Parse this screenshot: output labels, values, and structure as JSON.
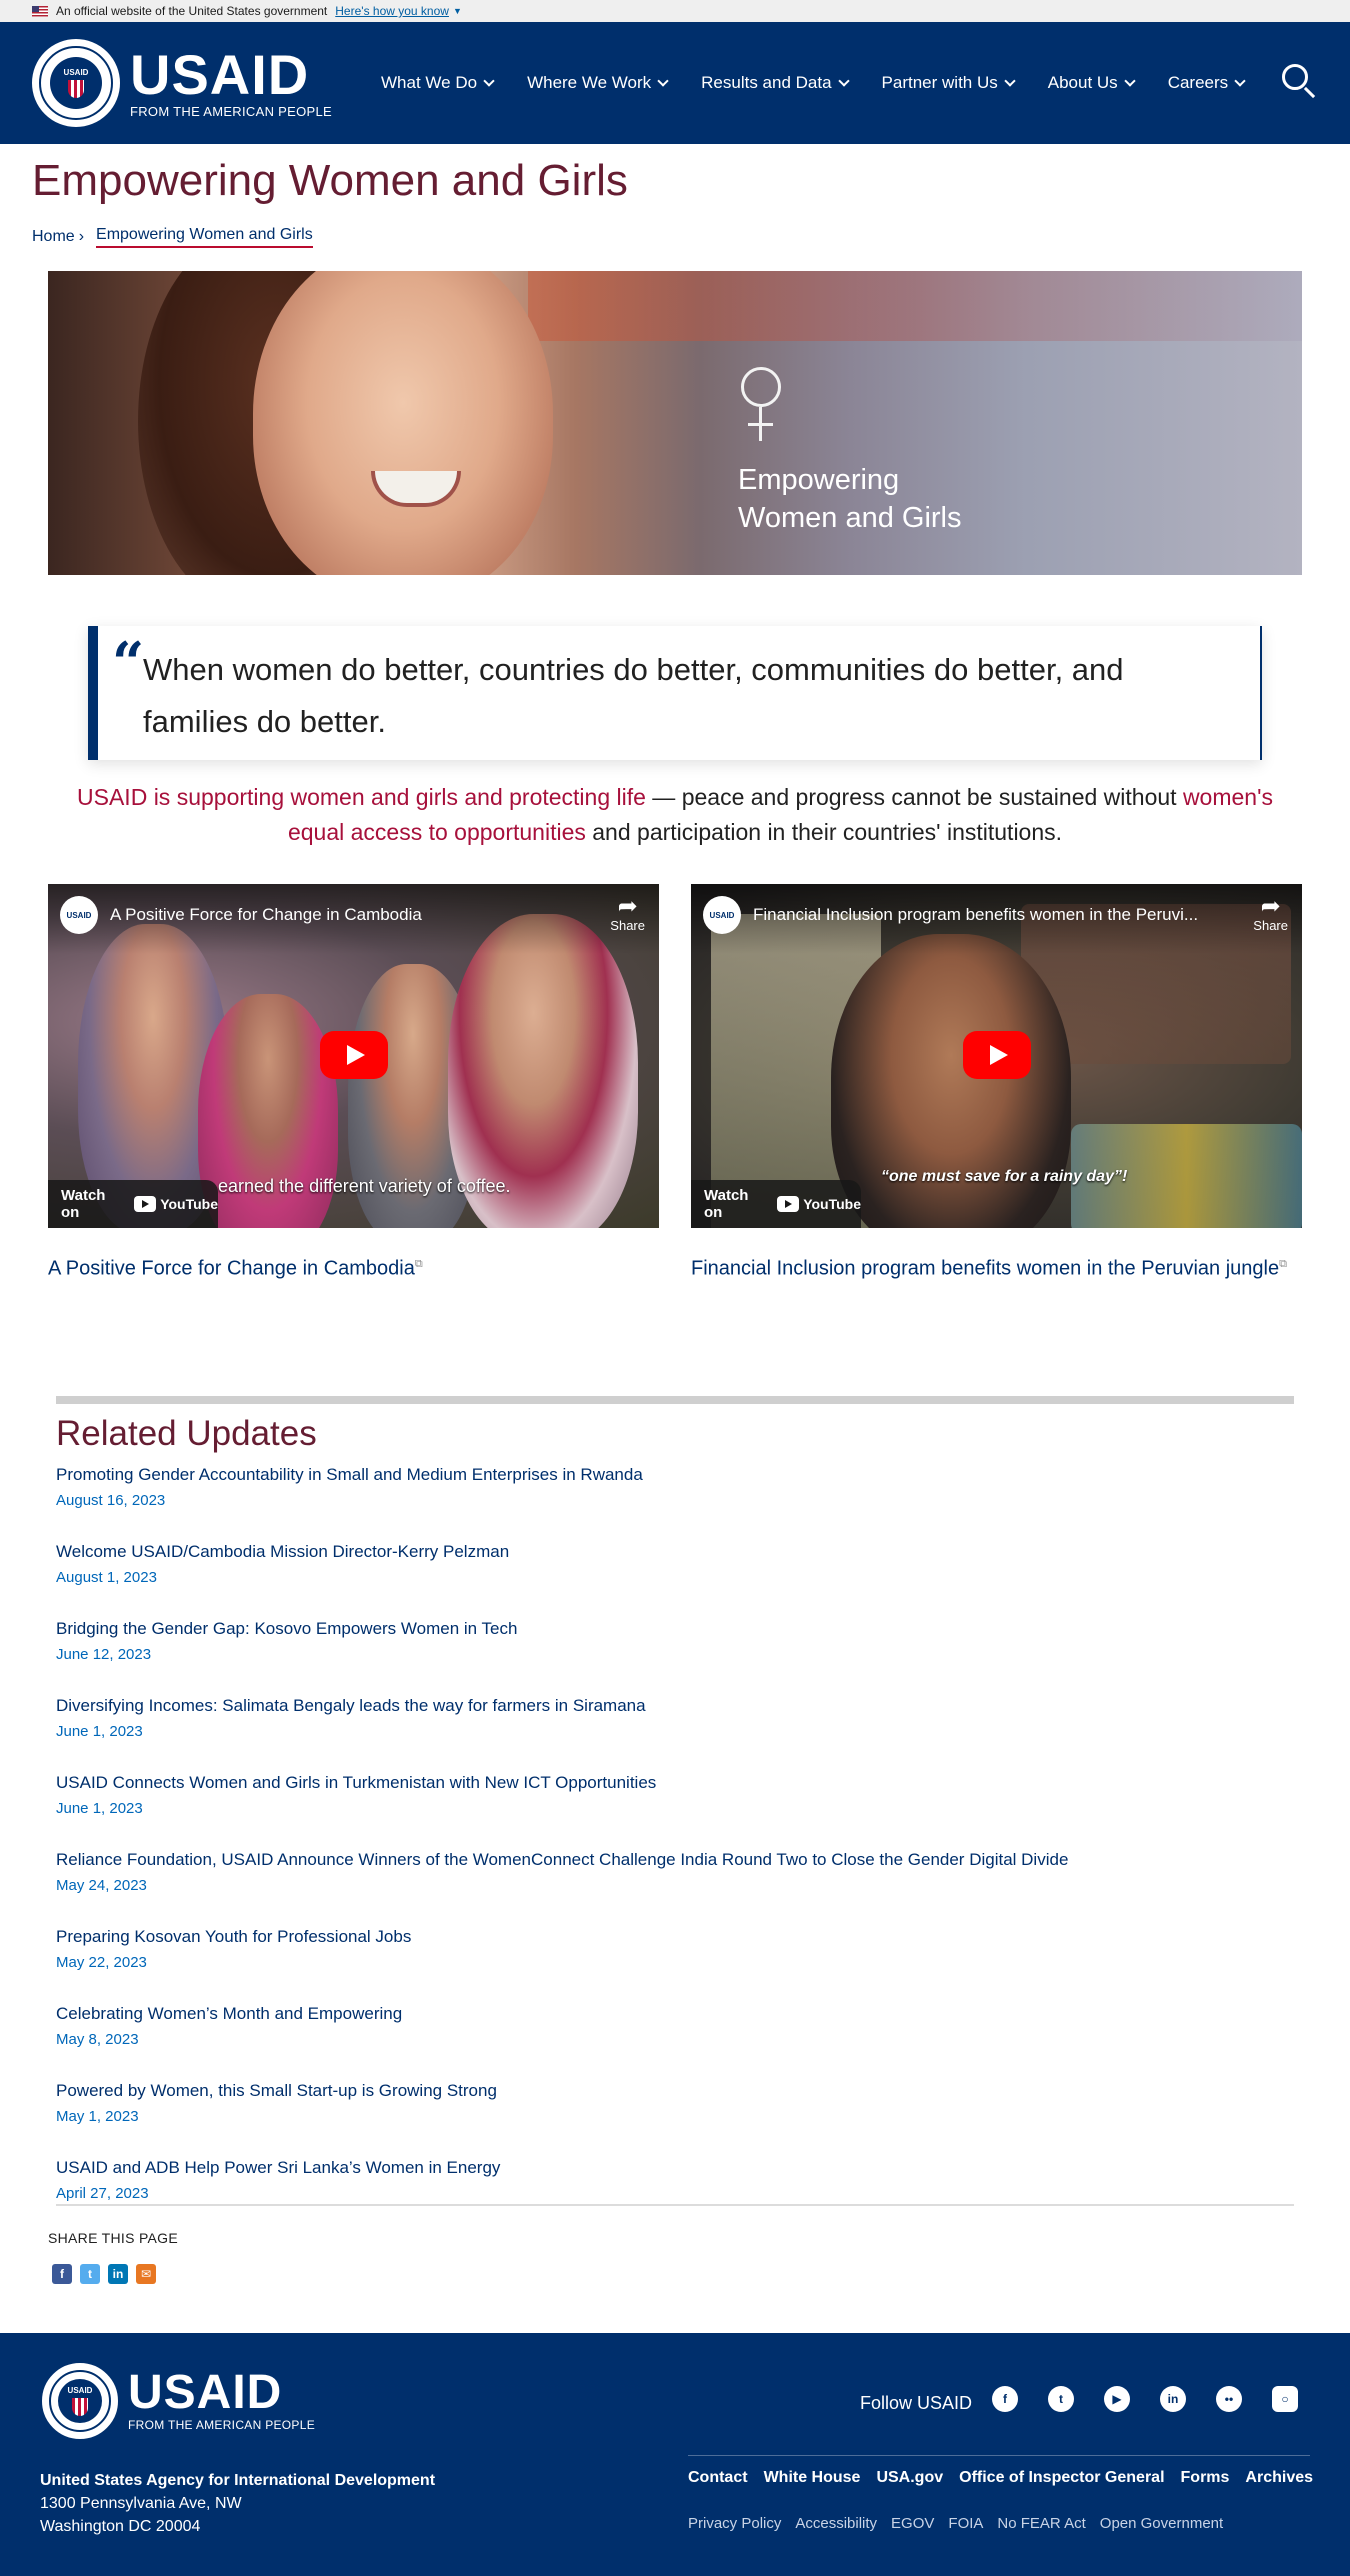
{
  "gov_banner": {
    "text": "An official website of the United States government",
    "link": "Here's how you know"
  },
  "header": {
    "seal_text": "USAID",
    "wordmark": "USAID",
    "tagline": "FROM THE AMERICAN PEOPLE",
    "nav": [
      "What We Do",
      "Where We Work",
      "Results and Data",
      "Partner with Us",
      "About Us",
      "Careers"
    ]
  },
  "page": {
    "title": "Empowering Women and Girls",
    "breadcrumb": {
      "home": "Home",
      "separator": "›",
      "current": "Empowering Women and Girls"
    }
  },
  "hero": {
    "line1": "Empowering",
    "line2": "Women and Girls"
  },
  "quote": {
    "mark": "“",
    "text": "When women do better, countries do better, communities do better, and families do better."
  },
  "intro": {
    "link1": "USAID is supporting women and girls and protecting life",
    "middle": " — peace and progress cannot be sustained without ",
    "link2": "women's equal access to opportunities",
    "end": " and participation in their countries' institutions."
  },
  "videos": [
    {
      "embed_title": "A Positive Force for Change in Cambodia",
      "caption": "earned the different variety of coffee.",
      "link": "A Positive Force for Change in Cambodia"
    },
    {
      "embed_title": "Financial Inclusion program benefits women in the Peruvi...",
      "caption": "“one must save for a rainy day”!",
      "link": "Financial Inclusion program benefits women in the Peruvian jungle"
    }
  ],
  "video_ui": {
    "share": "Share",
    "watch_on": "Watch on",
    "youtube": "YouTube",
    "channel": "USAID"
  },
  "related": {
    "heading": "Related Updates",
    "items": [
      {
        "title": "Promoting Gender Accountability in Small and Medium Enterprises in Rwanda",
        "date": "August 16, 2023"
      },
      {
        "title": "Welcome USAID/Cambodia Mission Director-Kerry Pelzman",
        "date": "August 1, 2023"
      },
      {
        "title": "Bridging the Gender Gap: Kosovo Empowers Women in Tech",
        "date": "June 12, 2023"
      },
      {
        "title": "Diversifying Incomes: Salimata Bengaly leads the way for farmers in Siramana",
        "date": "June 1, 2023"
      },
      {
        "title": "USAID Connects Women and Girls in Turkmenistan with New ICT Opportunities",
        "date": "June 1, 2023"
      },
      {
        "title": "Reliance Foundation, USAID Announce Winners of the WomenConnect Challenge India Round Two to Close the Gender Digital Divide",
        "date": "May 24, 2023"
      },
      {
        "title": "Preparing Kosovan Youth for Professional Jobs",
        "date": "May 22, 2023"
      },
      {
        "title": "Celebrating Women’s Month and Empowering",
        "date": "May 8, 2023"
      },
      {
        "title": "Powered by Women, this Small Start-up is Growing Strong",
        "date": "May 1, 2023"
      },
      {
        "title": "USAID and ADB Help Power Sri Lanka’s Women in Energy",
        "date": "April 27, 2023"
      }
    ]
  },
  "share": {
    "label": "SHARE THIS PAGE",
    "icons": [
      "facebook-icon",
      "twitter-icon",
      "linkedin-icon",
      "email-icon"
    ]
  },
  "footer": {
    "follow": "Follow USAID",
    "socials": [
      "facebook-icon",
      "twitter-icon",
      "youtube-icon",
      "linkedin-icon",
      "flickr-icon",
      "instagram-icon"
    ],
    "agency_name": "United States Agency for International Development",
    "address1": "1300 Pennsylvania Ave, NW",
    "address2": "Washington DC 20004",
    "primary_links": [
      "Contact",
      "White House",
      "USA.gov",
      "Office of Inspector General",
      "Forms",
      "Archives"
    ],
    "secondary_links": [
      "Privacy Policy",
      "Accessibility",
      "EGOV",
      "FOIA",
      "No FEAR Act",
      "Open Government"
    ]
  },
  "colors": {
    "navy": "#002f6c",
    "crimson": "#651d32",
    "red": "#ba0c2f",
    "link_blue": "#0067b9"
  }
}
